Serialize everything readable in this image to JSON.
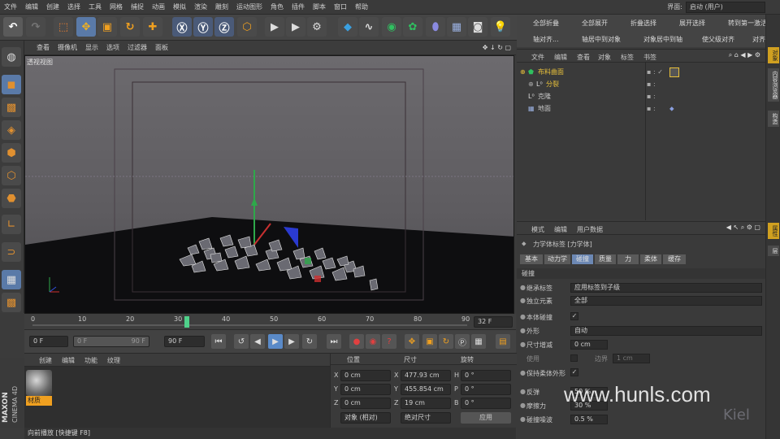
{
  "menu": [
    "文件",
    "编辑",
    "创建",
    "选择",
    "工具",
    "网格",
    "捕捉",
    "动画",
    "模拟",
    "渲染",
    "雕刻",
    "运动图形",
    "角色",
    "插件",
    "脚本",
    "窗口",
    "帮助"
  ],
  "interface": {
    "label": "界面:",
    "value": "启动 (用户)"
  },
  "right_toolbar": {
    "row1": [
      "全部折叠",
      "全部展开",
      "折叠选择",
      "展开选择",
      "转到第一激活对象"
    ],
    "row2": [
      "轴对齐...",
      "轴居中到对象",
      "对象居中到轴",
      "使父级对齐",
      "对齐到"
    ]
  },
  "viewport": {
    "menu": [
      "查看",
      "摄像机",
      "显示",
      "选项",
      "过滤器",
      "面板"
    ],
    "label": "透视视图"
  },
  "timeline": {
    "ticks": [
      "0",
      "10",
      "20",
      "30",
      "40",
      "50",
      "60",
      "70",
      "80",
      "90"
    ],
    "current": "32 F"
  },
  "transport": {
    "start": "0 F",
    "range_start": "0 F",
    "range_end": "90 F",
    "end": "90 F"
  },
  "material": {
    "menu": [
      "创建",
      "编辑",
      "功能",
      "纹理"
    ],
    "name": "材质"
  },
  "coords": {
    "headers": [
      "位置",
      "尺寸",
      "旋转"
    ],
    "rows": [
      {
        "axis": "X",
        "pos": "0 cm",
        "size_axis": "X",
        "size": "477.93 cm",
        "rot_axis": "H",
        "rot": "0 °"
      },
      {
        "axis": "Y",
        "pos": "0 cm",
        "size_axis": "Y",
        "size": "455.854 cm",
        "rot_axis": "P",
        "rot": "0 °"
      },
      {
        "axis": "Z",
        "pos": "0 cm",
        "size_axis": "Z",
        "size": "19 cm",
        "rot_axis": "B",
        "rot": "0 °"
      }
    ],
    "mode": "对象 (相对)",
    "size_mode": "绝对尺寸",
    "apply": "应用"
  },
  "status": "向前播放 [快捷键 F8]",
  "brand": {
    "maxon": "MAXON",
    "c4d": "CINEMA 4D"
  },
  "objects": {
    "menu": [
      "文件",
      "编辑",
      "查看",
      "对象",
      "标签",
      "书签"
    ],
    "items": [
      {
        "name": "布料曲面",
        "color": "#e8c03a"
      },
      {
        "name": "分裂",
        "color": "#e8c03a"
      },
      {
        "name": "克隆",
        "color": "#d0d0d0"
      },
      {
        "name": "地面",
        "color": "#d0d0d0"
      }
    ]
  },
  "attributes": {
    "menu": [
      "模式",
      "编辑",
      "用户数据"
    ],
    "title": "力学体标签 [力学体]",
    "tabs": [
      "基本",
      "动力学",
      "碰撞",
      "质量",
      "力",
      "柔体",
      "缓存"
    ],
    "active_tab": "碰撞",
    "section": "碰撞",
    "props": [
      {
        "label": "继承标签",
        "value": "应用标签到子级"
      },
      {
        "label": "独立元素",
        "value": "全部"
      },
      {
        "label": "本体碰撞",
        "value": "✓"
      },
      {
        "label": "外形",
        "value": "自动"
      },
      {
        "label": "尺寸增减",
        "value": "0 cm"
      },
      {
        "label": "使用",
        "value": "",
        "extra_label": "边界",
        "extra_value": "1 cm"
      },
      {
        "label": "保持柔体外形",
        "value": "✓"
      },
      {
        "label": "反弹",
        "value": "50 %"
      },
      {
        "label": "摩擦力",
        "value": "30 %"
      },
      {
        "label": "碰撞噪波",
        "value": "0.5 %"
      }
    ]
  },
  "watermark": {
    "text": "www.hunls.com",
    "logo": "Kiel"
  },
  "right_tabs": [
    "对象",
    "内容浏览器",
    "构造",
    "属性",
    "层"
  ]
}
